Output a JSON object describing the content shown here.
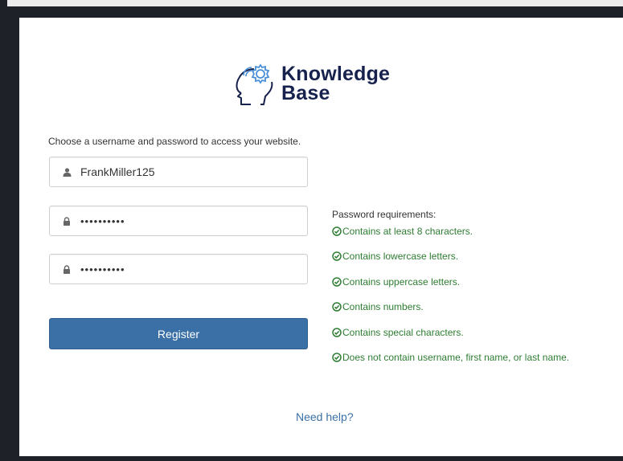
{
  "logo": {
    "line1": "Knowledge",
    "line2": "Base"
  },
  "intro_text": "Choose a username and password to access your website.",
  "fields": {
    "username": {
      "value": "FrankMiller125",
      "icon": "user-icon"
    },
    "password": {
      "value": "••••••••••",
      "icon": "lock-icon"
    },
    "confirm_password": {
      "value": "••••••••••",
      "icon": "lock-icon"
    }
  },
  "register_label": "Register",
  "requirements": {
    "title": "Password requirements:",
    "items": [
      "Contains at least 8 characters.",
      "Contains lowercase letters.",
      "Contains uppercase letters.",
      "Contains numbers.",
      "Contains special characters.",
      "Does not contain username, first name, or last name."
    ],
    "icon": "check-circle-icon",
    "met_color": "#2e7d32"
  },
  "help_link": "Need help?",
  "colors": {
    "brand_navy": "#16214d",
    "accent_blue": "#3a70a6",
    "gear_blue": "#4a90d9"
  }
}
